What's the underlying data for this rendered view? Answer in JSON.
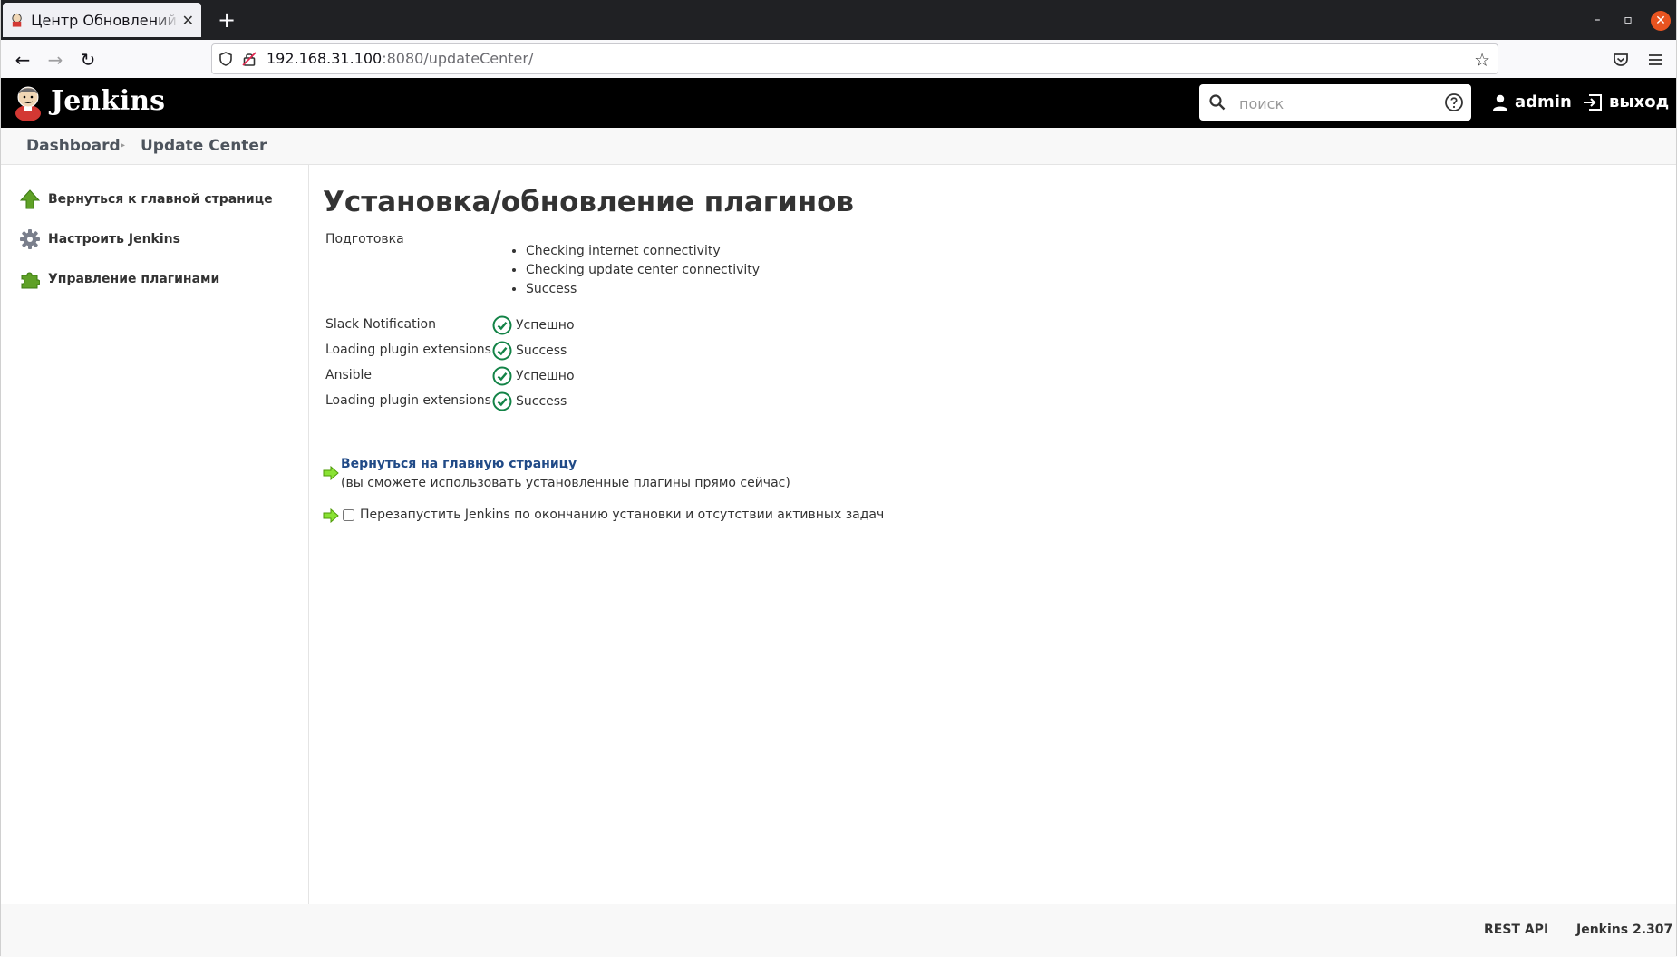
{
  "browser": {
    "tab_title": "Центр Обновлений [Jenkins]",
    "url_host": "192.168.31.100",
    "url_rest": ":8080/updateCenter/"
  },
  "header": {
    "app_name": "Jenkins",
    "search_placeholder": "поиск",
    "user": "admin",
    "logout": "выход"
  },
  "breadcrumb": [
    "Dashboard",
    "Update Center"
  ],
  "sidebar": {
    "items": [
      {
        "label": "Вернуться к главной странице",
        "icon": "up-arrow-icon"
      },
      {
        "label": "Настроить Jenkins",
        "icon": "gear-icon"
      },
      {
        "label": "Управление плагинами",
        "icon": "puzzle-icon"
      }
    ]
  },
  "main": {
    "title": "Установка/обновление плагинов",
    "prep_label": "Подготовка",
    "prep_steps": [
      "Checking internet connectivity",
      "Checking update center connectivity",
      "Success"
    ],
    "jobs": [
      {
        "name": "Slack Notification",
        "status": "Успешно"
      },
      {
        "name": "Loading plugin extensions",
        "status": "Success"
      },
      {
        "name": "Ansible",
        "status": "Успешно"
      },
      {
        "name": "Loading plugin extensions",
        "status": "Success"
      }
    ],
    "back_link": "Вернуться на главную страницу",
    "back_note": "(вы сможете использовать установленные плагины прямо сейчас)",
    "restart_label": "Перезапустить Jenkins по окончанию установки и отсутствии активных задач",
    "restart_checked": false
  },
  "footer": {
    "rest_api": "REST API",
    "version": "Jenkins 2.307"
  },
  "colors": {
    "header_bg": "#000000",
    "success_green": "#138347",
    "link_blue": "#204a87",
    "arrow_green": "#4e9a06"
  }
}
